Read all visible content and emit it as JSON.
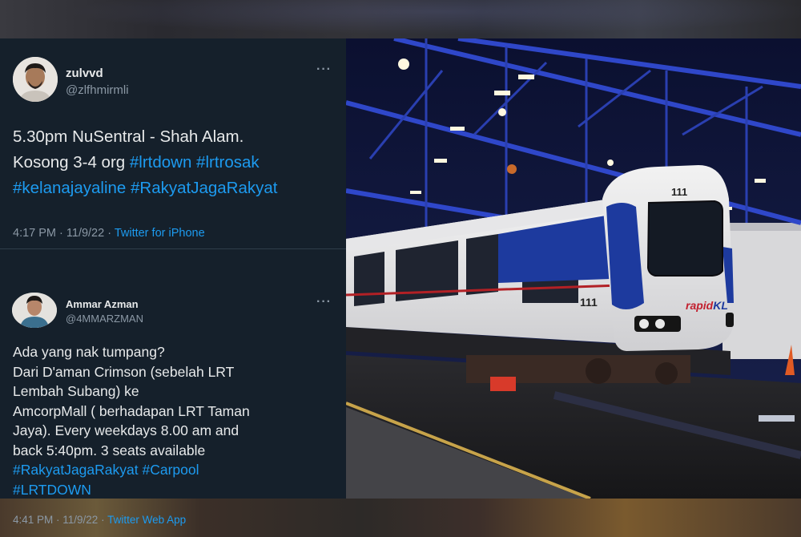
{
  "tweet1": {
    "display_name": "zulvvd",
    "handle": "@zlfhmirmli",
    "more": "···",
    "text_lines": [
      {
        "plain": "5.30pm NuSentral - Shah Alam.",
        "tags": ""
      },
      {
        "plain": "Kosong 3-4 org ",
        "tags": "#lrtdown #lrtrosak"
      },
      {
        "plain": "",
        "tags": "#kelanajayaline #RakyatJagaRakyat"
      }
    ],
    "time": "4:17 PM · 11/9/22 · ",
    "source": "Twitter for iPhone"
  },
  "tweet2": {
    "display_name": "Ammar Azman",
    "handle": "@4MMARZMAN",
    "more": "···",
    "text_lines": [
      "Ada yang nak tumpang?",
      "Dari D'aman Crimson (sebelah LRT",
      "Lembah Subang) ke",
      "AmcorpMall ( berhadapan LRT Taman",
      "Jaya). Every weekdays 8.00 am and",
      "back 5:40pm. 3 seats available"
    ],
    "tag_lines": [
      "#RakyatJagaRakyat #Carpool",
      "#LRTDOWN"
    ],
    "time": "4:41 PM · 11/9/22 · ",
    "source": "Twitter Web App"
  },
  "photo": {
    "train_number_front": "111",
    "train_number_side": "111",
    "brand_rapid": "rapid",
    "brand_kl": "KL"
  },
  "colors": {
    "tweet_bg": "#15202b",
    "hashtag": "#1d9bf0",
    "muted": "#8b98a5",
    "train_blue": "#1d3a9e"
  }
}
